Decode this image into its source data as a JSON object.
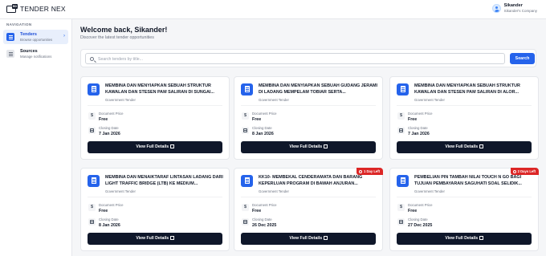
{
  "app": {
    "logo_text": "TENDER NEX",
    "logo_badge": "BD"
  },
  "user": {
    "name": "Sikander",
    "company": "Sikander's Company"
  },
  "nav": {
    "heading": "NAVIGATION",
    "items": [
      {
        "label": "Tenders",
        "sub": "Browse opportunities",
        "active": true,
        "chevron": "›"
      },
      {
        "label": "Sources",
        "sub": "Manage notifications",
        "active": false
      }
    ]
  },
  "welcome": {
    "title": "Welcome back, Sikander!",
    "subtitle": "Discover the latest tender opportunities"
  },
  "search": {
    "placeholder": "Search tenders by title...",
    "button": "Search"
  },
  "labels": {
    "price": "Document Price",
    "closing": "Closing Date",
    "view": "View Full Details"
  },
  "tenders": [
    {
      "title": "MEMBINA DAN MENYIAPKAN SEBUAH STRUKTUR KAWALAN DAN STESEN PAM SALIRAN DI SUNGAI...",
      "category": "Government Tender",
      "price": "Free",
      "closing": "7 Jan 2026",
      "badge": ""
    },
    {
      "title": "MEMBINA DAN MENYIAPKAN SEBUAH GUDANG JERAMI DI LADANG MEMPELAM TOBIAR SERTA...",
      "category": "Government Tender",
      "price": "Free",
      "closing": "8 Jan 2026",
      "badge": ""
    },
    {
      "title": "MEMBINA DAN MENYIAPKAN SEBUAH STRUKTUR KAWALAN DAN STESEN PAM SALIRAN DI ALOR...",
      "category": "Government Tender",
      "price": "Free",
      "closing": "7 Jan 2026",
      "badge": ""
    },
    {
      "title": "MEMBINA DAN MENAIKTARAF LINTASAN LADANG DARI LIGHT TRAFFIC BRIDGE (LTB) KE MEDIUM...",
      "category": "Government Tender",
      "price": "Free",
      "closing": "8 Jan 2026",
      "badge": ""
    },
    {
      "title": "KK10- MEMBEKAL CENDERAMATA DAN BARANG KEPERLUAN PROGRAM DI BAWAH ANJURAN...",
      "category": "Government Tender",
      "price": "Free",
      "closing": "26 Dec 2025",
      "badge": "1 Day Left"
    },
    {
      "title": "PEMBELIAN PIN TAMBAH NILAI TOUCH N GO BAGI TUJUAN PEMBAYARAN SAGUHATI SOAL SELIDIK...",
      "category": "Government Tender",
      "price": "Free",
      "closing": "27 Dec 2025",
      "badge": "2 Days Left"
    }
  ]
}
